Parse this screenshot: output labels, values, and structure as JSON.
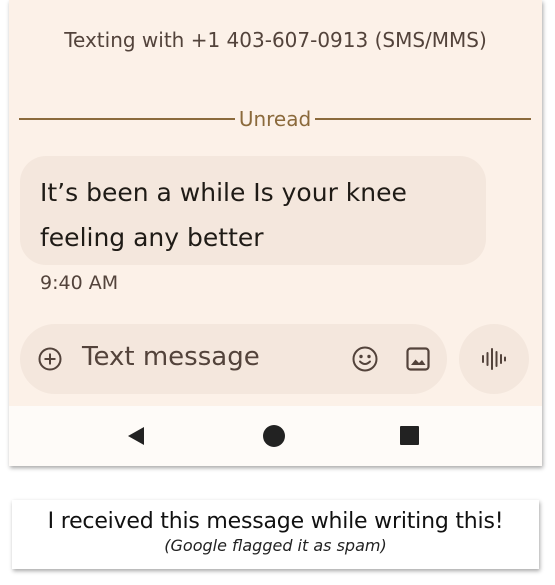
{
  "header": {
    "texting_with": "Texting with +1 403-607-0913 (SMS/MMS)"
  },
  "divider": {
    "label": "Unread"
  },
  "message": {
    "line1": "It’s been a while Is your knee",
    "line2": "feeling any better",
    "time": "9:40 AM"
  },
  "compose": {
    "placeholder": "Text message",
    "icons": [
      "add-circle-icon",
      "emoji-icon",
      "gallery-icon",
      "voice-waveform-icon"
    ]
  },
  "nav": {
    "icons": [
      "back-triangle-icon",
      "home-circle-icon",
      "recents-square-icon"
    ]
  },
  "caption": {
    "main": "I received this message while writing this!",
    "sub": "(Google flagged it as spam)"
  },
  "colors": {
    "background": "#fcf1e8",
    "bubble": "#f4e7dd",
    "divider_accent": "#8b6a3c",
    "text_primary": "#1f1b16",
    "text_secondary": "#53433b"
  }
}
